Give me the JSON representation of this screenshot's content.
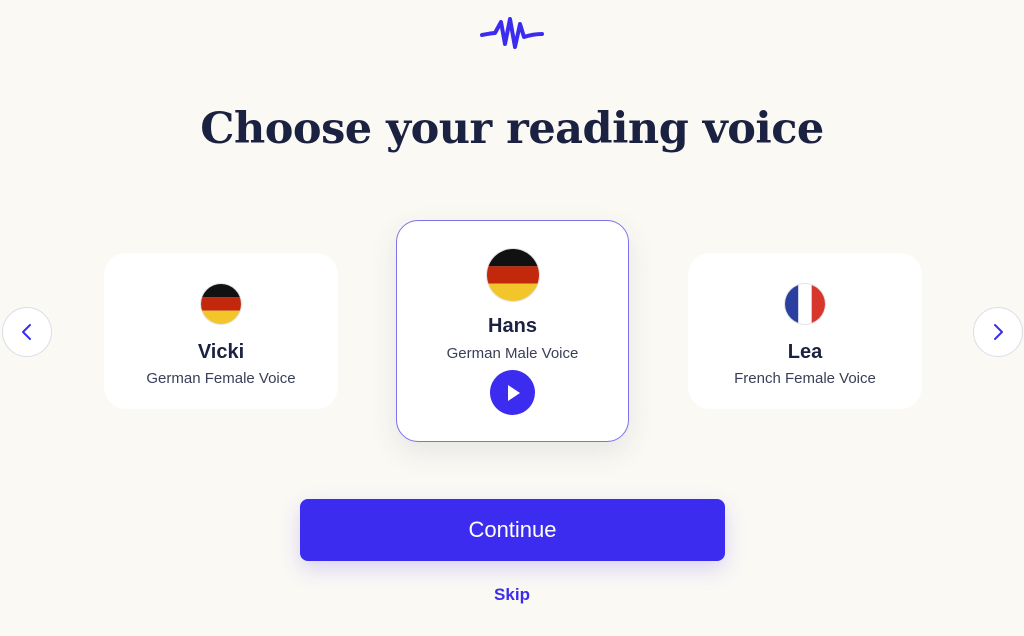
{
  "header": {
    "logo_icon": "waveform-icon",
    "title": "Choose your reading voice"
  },
  "carousel": {
    "prev_icon": "chevron-left-icon",
    "next_icon": "chevron-right-icon",
    "voices": [
      {
        "name": "Vicki",
        "description": "German Female Voice",
        "flag": "germany-flag-icon",
        "selected": false
      },
      {
        "name": "Hans",
        "description": "German Male Voice",
        "flag": "germany-flag-icon",
        "selected": true
      },
      {
        "name": "Lea",
        "description": "French Female Voice",
        "flag": "france-flag-icon",
        "selected": false
      }
    ],
    "play_icon": "play-icon"
  },
  "actions": {
    "continue_label": "Continue",
    "skip_label": "Skip"
  },
  "colors": {
    "accent": "#3c2cf0",
    "background": "#fbf9f4",
    "text": "#1b2140",
    "selected_border": "#7b72ee"
  }
}
